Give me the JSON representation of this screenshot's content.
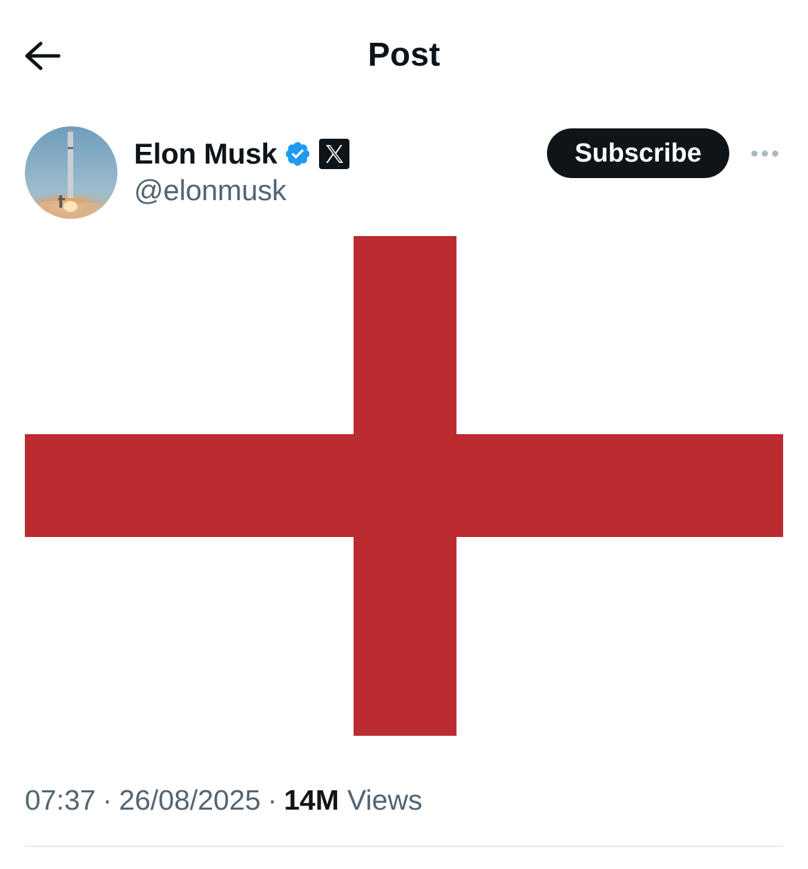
{
  "header": {
    "back_icon": "arrow-left-icon",
    "title": "Post"
  },
  "author": {
    "name": "Elon Musk",
    "handle": "@elonmusk",
    "verified_icon": "verified-badge-icon",
    "affiliate_icon": "x-logo-icon",
    "avatar_icon": "rocket-launch-avatar"
  },
  "actions": {
    "subscribe_label": "Subscribe",
    "more_icon": "more-dots-icon"
  },
  "media": {
    "description_icon": "england-flag-image",
    "colors": {
      "cross": "#bb2b30",
      "field": "#ffffff"
    }
  },
  "meta": {
    "time": "07:37",
    "separator": "·",
    "date": "26/08/2025",
    "views_count": "14M",
    "views_label": "Views"
  },
  "colors": {
    "text_primary": "#0f1419",
    "text_secondary": "#536471",
    "verified_blue": "#1d9bf0",
    "divider": "#e7e9ea"
  }
}
